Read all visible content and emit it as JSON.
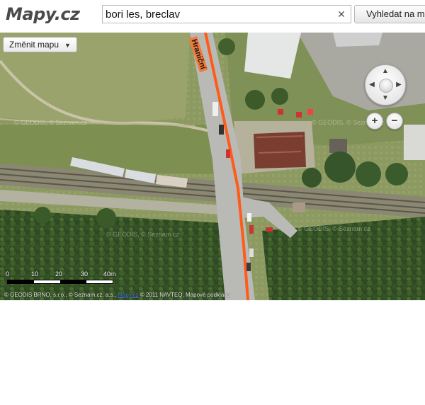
{
  "header": {
    "logo_text": "Mapy.cz",
    "search": {
      "value": "bori les, breclav",
      "clear_icon": "close-icon"
    },
    "submit_label": "Vyhledat na ma"
  },
  "map": {
    "map_type_label": "Změnit mapu",
    "street_label": "Hraniční",
    "scale": {
      "labels": [
        "0",
        "10",
        "20",
        "30",
        "40m"
      ]
    },
    "copyright": {
      "prefix": "© GEODIS BRNO, s.r.o., © Seznam.cz, a.s.,",
      "link": "Mapy.cz",
      "suffix": "© 2011 NAVTEQ, Mapové podklady"
    },
    "watermarks": [
      "© GEODIS, © Seznam.cz",
      "© GEODIS, © Seznam.cz",
      "© GEODIS, © Seznam.cz",
      "© GEODIS, © Seznam.cz"
    ]
  },
  "colors": {
    "road_line": "#ff5b1a",
    "logo_red": "#c8102e"
  }
}
